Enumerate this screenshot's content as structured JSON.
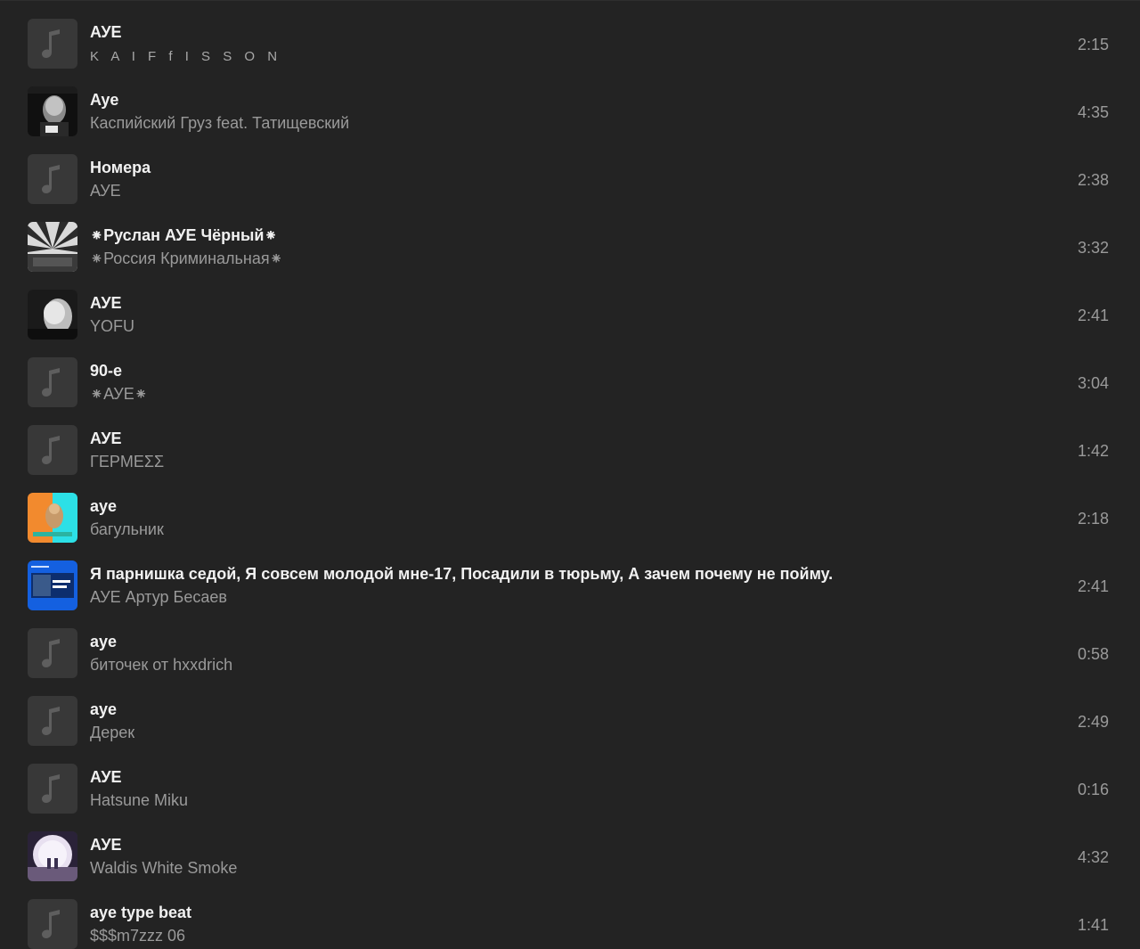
{
  "tracks": [
    {
      "title": "АУЕ",
      "artist": "K A I F f I S S O N",
      "duration": "2:15",
      "cover": "music-note-icon"
    },
    {
      "title": "Aye",
      "artist": "Каспийский Груз feat. Татищевский",
      "duration": "4:35",
      "cover": "album-cover"
    },
    {
      "title": "Номера",
      "artist": "АУЕ",
      "duration": "2:38",
      "cover": "music-note-icon"
    },
    {
      "title": "⁕Руслан АУЕ Чёрный⁕",
      "artist": "⁕Россия Криминальная⁕",
      "duration": "3:32",
      "cover": "album-cover"
    },
    {
      "title": "АУЕ",
      "artist": "YOFU",
      "duration": "2:41",
      "cover": "album-cover"
    },
    {
      "title": "90-е",
      "artist": "⁕АУЕ⁕",
      "duration": "3:04",
      "cover": "music-note-icon"
    },
    {
      "title": "АУЕ",
      "artist": "ΓΕΡΜΕΣΣ",
      "duration": "1:42",
      "cover": "music-note-icon"
    },
    {
      "title": "aye",
      "artist": "багульник",
      "duration": "2:18",
      "cover": "album-cover"
    },
    {
      "title": "Я парнишка седой, Я совсем молодой мне-17, Посадили в тюрьму, А зачем почему не пойму.",
      "artist": "АУЕ Артур Бесаев",
      "duration": "2:41",
      "cover": "album-cover"
    },
    {
      "title": "aye",
      "artist": "биточек от hxxdrich",
      "duration": "0:58",
      "cover": "music-note-icon"
    },
    {
      "title": "aye",
      "artist": "Дерек",
      "duration": "2:49",
      "cover": "music-note-icon"
    },
    {
      "title": "АУЕ",
      "artist": "Hatsune Miku",
      "duration": "0:16",
      "cover": "music-note-icon"
    },
    {
      "title": "АУЕ",
      "artist": "Waldis White Smoke",
      "duration": "4:32",
      "cover": "album-cover"
    },
    {
      "title": "aye type beat",
      "artist": "$$$m7zzz 06",
      "duration": "1:41",
      "cover": "music-note-icon"
    }
  ],
  "colors": {
    "background": "#232323",
    "title": "#f1f1f1",
    "secondary": "#9a9a9a",
    "placeholder": "#383838"
  }
}
